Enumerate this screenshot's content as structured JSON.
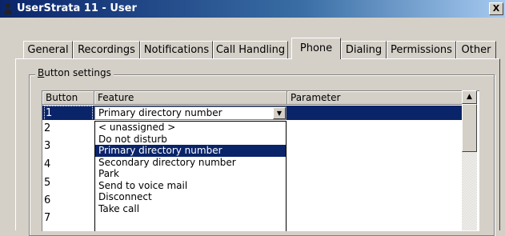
{
  "window": {
    "title": "UserStrata 11 - User",
    "close_glyph": "X"
  },
  "tabs": [
    {
      "label": "General",
      "active": false
    },
    {
      "label": "Recordings",
      "active": false
    },
    {
      "label": "Notifications",
      "active": false
    },
    {
      "label": "Call Handling",
      "active": false
    },
    {
      "label": "Phone",
      "active": true
    },
    {
      "label": "Dialing",
      "active": false
    },
    {
      "label": "Permissions",
      "active": false
    },
    {
      "label": "Other",
      "active": false
    }
  ],
  "group": {
    "title_prefix": "B",
    "title_rest": "utton settings"
  },
  "grid": {
    "columns": [
      "Button",
      "Feature",
      "Parameter"
    ],
    "rows": [
      "1",
      "2",
      "3",
      "4",
      "5",
      "6",
      "7"
    ],
    "selected_row": "1",
    "feature_value": "Primary directory number",
    "dropdown_glyph": "▼"
  },
  "dropdown": {
    "options": [
      "< unassigned >",
      "Do not disturb",
      "Primary directory number",
      "Secondary directory number",
      "Park",
      "Send to voice mail",
      "Disconnect",
      "Take call"
    ],
    "highlighted_index": 2
  },
  "scrollbar": {
    "up_glyph": "▲"
  },
  "colors": {
    "selection": "#0a246a",
    "face": "#d4d0c8"
  }
}
